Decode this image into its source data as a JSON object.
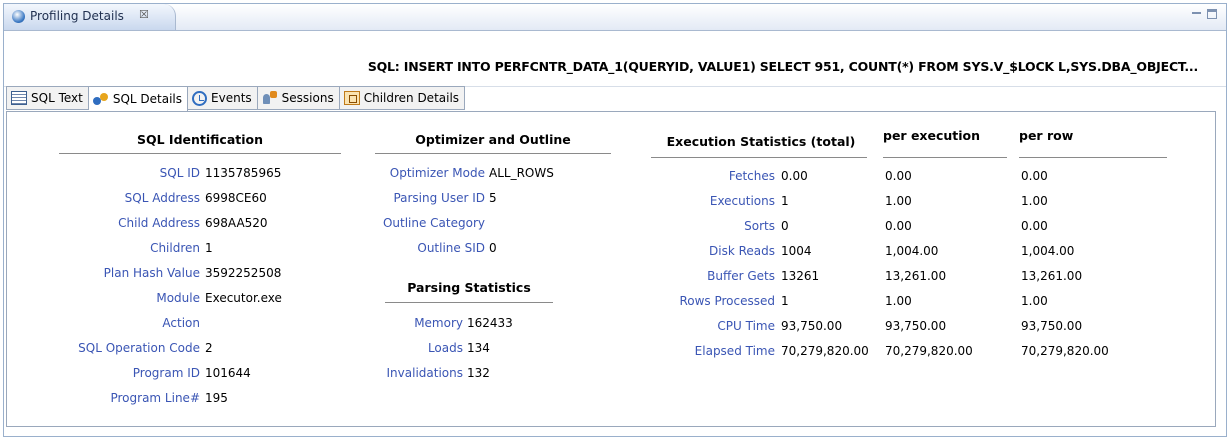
{
  "view": {
    "tab_title": "Profiling Details",
    "close_glyph": "☒"
  },
  "sql_statement": "SQL: INSERT INTO PERFCNTR_DATA_1(QUERYID, VALUE1) SELECT 951, COUNT(*) FROM SYS.V_$LOCK L,SYS.DBA_OBJECT...",
  "tabs": [
    {
      "label": "SQL Text",
      "icon": "sql-text-icon"
    },
    {
      "label": "SQL Details",
      "icon": "sql-details-icon"
    },
    {
      "label": "Events",
      "icon": "events-icon"
    },
    {
      "label": "Sessions",
      "icon": "sessions-icon"
    },
    {
      "label": "Children Details",
      "icon": "children-details-icon"
    }
  ],
  "sql_identification": {
    "heading": "SQL Identification",
    "rows": [
      {
        "label": "SQL ID",
        "value": "1135785965"
      },
      {
        "label": "SQL Address",
        "value": "6998CE60"
      },
      {
        "label": "Child Address",
        "value": "698AA520"
      },
      {
        "label": "Children",
        "value": "1"
      },
      {
        "label": "Plan Hash Value",
        "value": "3592252508"
      },
      {
        "label": "Module",
        "value": "Executor.exe"
      },
      {
        "label": "Action",
        "value": ""
      },
      {
        "label": "SQL Operation Code",
        "value": "2"
      },
      {
        "label": "Program ID",
        "value": "101644"
      },
      {
        "label": "Program Line#",
        "value": "195"
      }
    ]
  },
  "optimizer": {
    "heading": "Optimizer and Outline",
    "rows": [
      {
        "label": "Optimizer Mode",
        "value": "ALL_ROWS"
      },
      {
        "label": "Parsing User ID",
        "value": "5"
      },
      {
        "label": "Outline Category",
        "value": ""
      },
      {
        "label": "Outline SID",
        "value": "0"
      }
    ]
  },
  "parsing": {
    "heading": "Parsing Statistics",
    "rows": [
      {
        "label": "Memory",
        "value": "162433"
      },
      {
        "label": "Loads",
        "value": "134"
      },
      {
        "label": "Invalidations",
        "value": "132"
      }
    ]
  },
  "execution": {
    "heading_total": "Execution Statistics (total)",
    "heading_per_exec": "per execution",
    "heading_per_row": "per row",
    "rows": [
      {
        "label": "Fetches",
        "total": "0.00",
        "per_exec": "0.00",
        "per_row": "0.00"
      },
      {
        "label": "Executions",
        "total": "1",
        "per_exec": "1.00",
        "per_row": "1.00"
      },
      {
        "label": "Sorts",
        "total": "0",
        "per_exec": "0.00",
        "per_row": "0.00"
      },
      {
        "label": "Disk Reads",
        "total": "1004",
        "per_exec": "1,004.00",
        "per_row": "1,004.00"
      },
      {
        "label": "Buffer Gets",
        "total": "13261",
        "per_exec": "13,261.00",
        "per_row": "13,261.00"
      },
      {
        "label": "Rows Processed",
        "total": "1",
        "per_exec": "1.00",
        "per_row": "1.00"
      },
      {
        "label": "CPU Time",
        "total": "93,750.00",
        "per_exec": "93,750.00",
        "per_row": "93,750.00"
      },
      {
        "label": "Elapsed Time",
        "total": "70,279,820.00",
        "per_exec": "70,279,820.00",
        "per_row": "70,279,820.00"
      }
    ]
  },
  "colors": {
    "label_link": "#3a55b4",
    "tab_border": "#9aa8bc",
    "view_tab_bg": "#c9d8ee"
  }
}
